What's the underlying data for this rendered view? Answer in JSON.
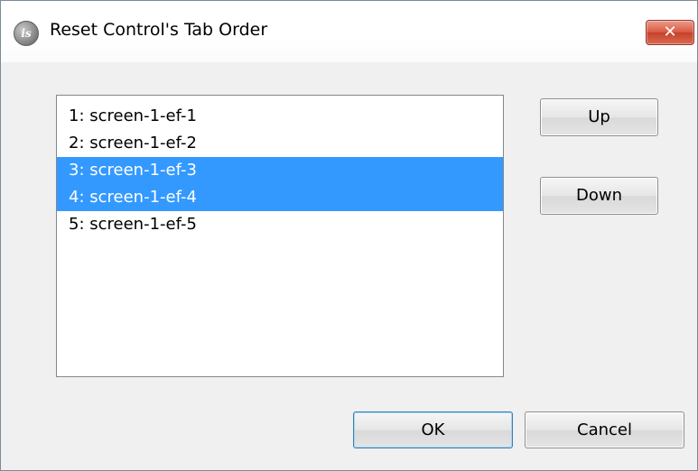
{
  "window": {
    "title": "Reset Control's Tab Order",
    "app_icon_text": "is",
    "close_glyph": "✕"
  },
  "list": {
    "items": [
      {
        "label": "1: screen-1-ef-1",
        "selected": false
      },
      {
        "label": "2: screen-1-ef-2",
        "selected": false
      },
      {
        "label": "3: screen-1-ef-3",
        "selected": true
      },
      {
        "label": "4: screen-1-ef-4",
        "selected": true
      },
      {
        "label": "5: screen-1-ef-5",
        "selected": false
      }
    ]
  },
  "buttons": {
    "up": "Up",
    "down": "Down",
    "ok": "OK",
    "cancel": "Cancel"
  },
  "colors": {
    "selection": "#3399ff",
    "close_button": "#c7412a"
  }
}
